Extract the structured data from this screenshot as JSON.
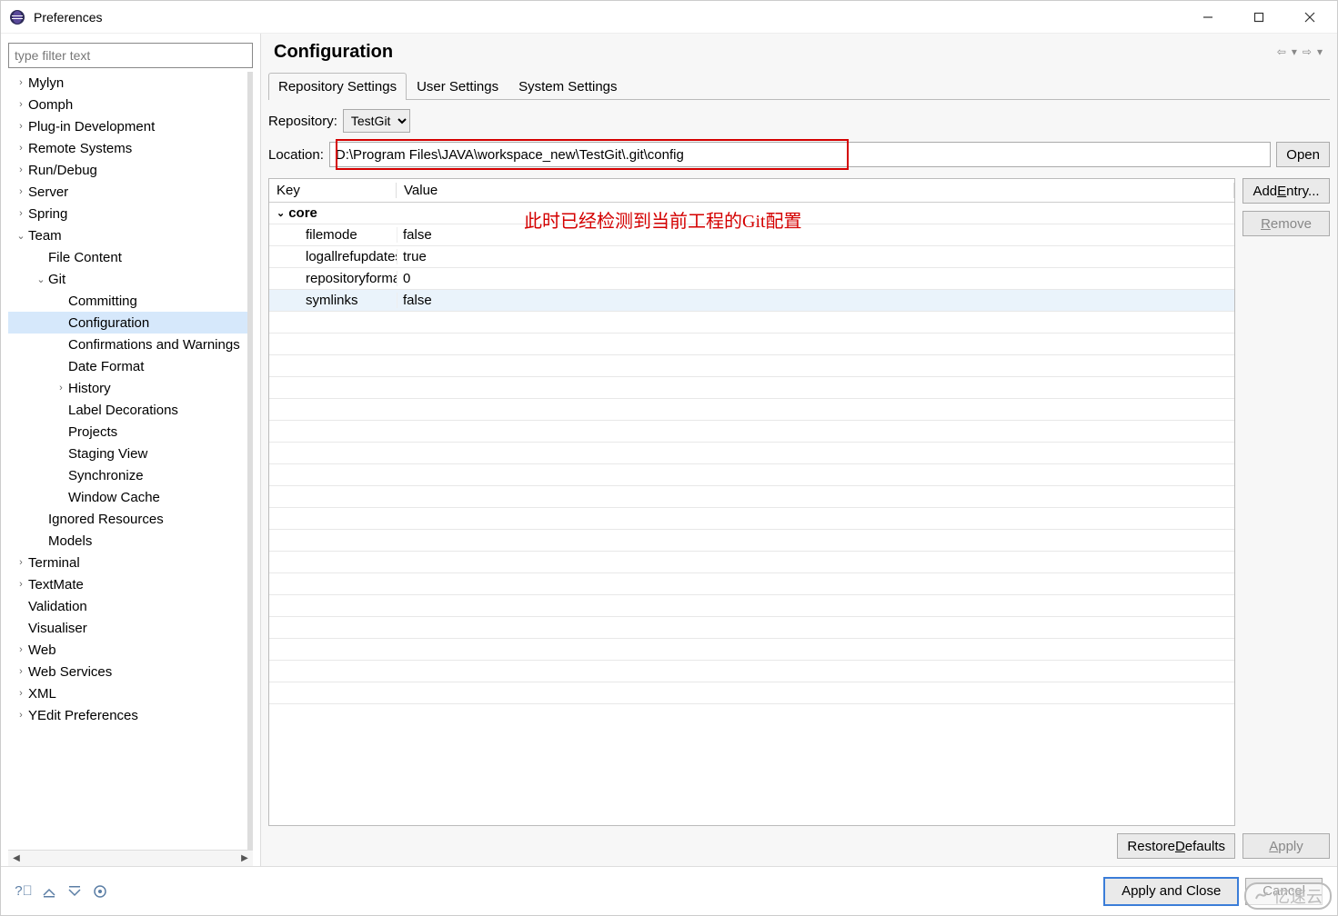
{
  "window": {
    "title": "Preferences"
  },
  "filter_placeholder": "type filter text",
  "page_title": "Configuration",
  "tabs": [
    "Repository Settings",
    "User Settings",
    "System Settings"
  ],
  "repository": {
    "label": "Repository:",
    "value": "TestGit"
  },
  "location": {
    "label": "Location:",
    "value": "D:\\Program Files\\JAVA\\workspace_new\\TestGit\\.git\\config"
  },
  "buttons": {
    "open": "Open",
    "add_entry": "Add Entry...",
    "remove": "Remove",
    "restore_defaults": "Restore Defaults",
    "apply": "Apply",
    "apply_close": "Apply and Close",
    "cancel": "Cancel"
  },
  "table": {
    "headers": {
      "key": "Key",
      "value": "Value"
    },
    "group": "core",
    "rows": [
      {
        "key": "filemode",
        "value": "false"
      },
      {
        "key": "logallrefupdates",
        "value": "true"
      },
      {
        "key": "repositoryformatversion",
        "value": "0"
      },
      {
        "key": "symlinks",
        "value": "false",
        "hl": true
      }
    ]
  },
  "annotation": "此时已经检测到当前工程的Git配置",
  "watermark": "亿速云",
  "tree": [
    {
      "label": "Mylyn",
      "depth": 0,
      "exp": ">"
    },
    {
      "label": "Oomph",
      "depth": 0,
      "exp": ">"
    },
    {
      "label": "Plug-in Development",
      "depth": 0,
      "exp": ">"
    },
    {
      "label": "Remote Systems",
      "depth": 0,
      "exp": ">"
    },
    {
      "label": "Run/Debug",
      "depth": 0,
      "exp": ">"
    },
    {
      "label": "Server",
      "depth": 0,
      "exp": ">"
    },
    {
      "label": "Spring",
      "depth": 0,
      "exp": ">"
    },
    {
      "label": "Team",
      "depth": 0,
      "exp": "v"
    },
    {
      "label": "File Content",
      "depth": 1,
      "exp": ""
    },
    {
      "label": "Git",
      "depth": 1,
      "exp": "v"
    },
    {
      "label": "Committing",
      "depth": 2,
      "exp": ""
    },
    {
      "label": "Configuration",
      "depth": 2,
      "exp": "",
      "selected": true
    },
    {
      "label": "Confirmations and Warnings",
      "depth": 2,
      "exp": ""
    },
    {
      "label": "Date Format",
      "depth": 2,
      "exp": ""
    },
    {
      "label": "History",
      "depth": 2,
      "exp": ">"
    },
    {
      "label": "Label Decorations",
      "depth": 2,
      "exp": ""
    },
    {
      "label": "Projects",
      "depth": 2,
      "exp": ""
    },
    {
      "label": "Staging View",
      "depth": 2,
      "exp": ""
    },
    {
      "label": "Synchronize",
      "depth": 2,
      "exp": ""
    },
    {
      "label": "Window Cache",
      "depth": 2,
      "exp": ""
    },
    {
      "label": "Ignored Resources",
      "depth": 1,
      "exp": ""
    },
    {
      "label": "Models",
      "depth": 1,
      "exp": ""
    },
    {
      "label": "Terminal",
      "depth": 0,
      "exp": ">"
    },
    {
      "label": "TextMate",
      "depth": 0,
      "exp": ">"
    },
    {
      "label": "Validation",
      "depth": 0,
      "exp": ""
    },
    {
      "label": "Visualiser",
      "depth": 0,
      "exp": ""
    },
    {
      "label": "Web",
      "depth": 0,
      "exp": ">"
    },
    {
      "label": "Web Services",
      "depth": 0,
      "exp": ">"
    },
    {
      "label": "XML",
      "depth": 0,
      "exp": ">"
    },
    {
      "label": "YEdit Preferences",
      "depth": 0,
      "exp": ">"
    }
  ]
}
